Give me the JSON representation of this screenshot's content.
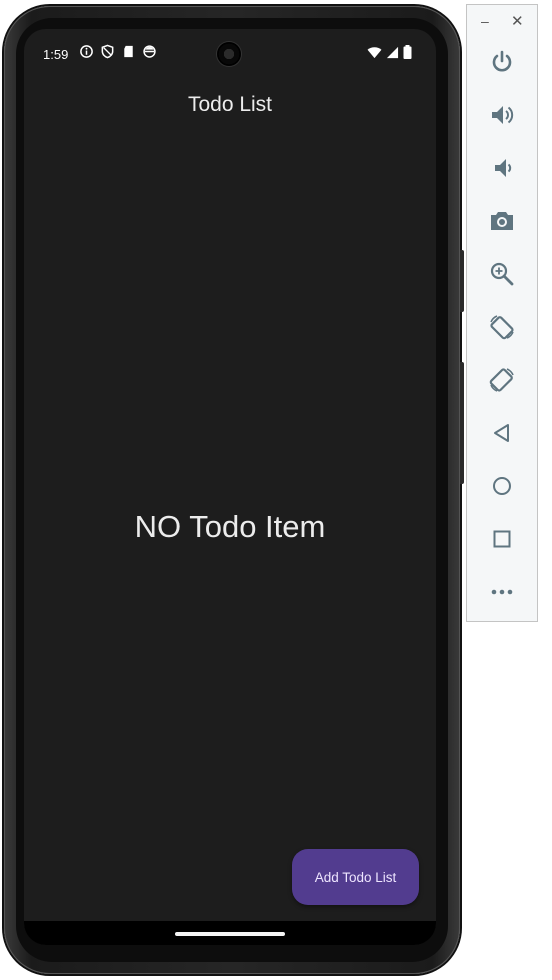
{
  "status_bar": {
    "time": "1:59",
    "left_icons": [
      "info-icon",
      "shield-icon",
      "sd-card-icon",
      "vpn-icon"
    ],
    "right_icons": [
      "wifi-icon",
      "signal-icon",
      "battery-icon"
    ]
  },
  "app": {
    "title": "Todo List",
    "empty_message": "NO Todo Item",
    "fab_label": "Add Todo List",
    "colors": {
      "background": "#1d1d1d",
      "fab": "#523c8f",
      "text": "#ececec"
    }
  },
  "emulator_toolbar": {
    "window_controls": {
      "minimize": "–",
      "close": "✕"
    },
    "buttons": [
      "power-icon",
      "volume-up-icon",
      "volume-down-icon",
      "camera-icon",
      "zoom-icon",
      "rotate-left-icon",
      "rotate-right-icon",
      "back-icon",
      "home-icon",
      "overview-icon",
      "more-icon"
    ]
  }
}
